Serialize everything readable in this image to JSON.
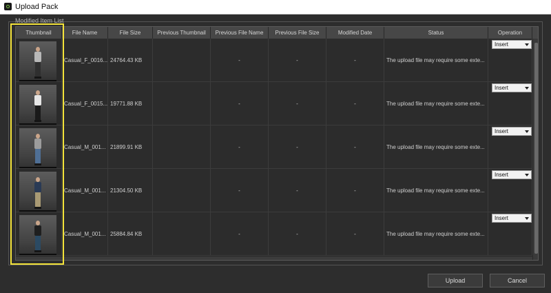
{
  "window": {
    "title": "Upload Pack"
  },
  "group": {
    "label": "Modified Item List"
  },
  "table": {
    "headers": [
      "Thumbnail",
      "File Name",
      "File Size",
      "Previous Thumbnail",
      "Previous File Name",
      "Previous File Size",
      "Modified Date",
      "Status",
      "Operation"
    ],
    "rows": [
      {
        "file_name": "Casual_F_0016...",
        "file_size": "24764.43 KB",
        "prev_thumb": "",
        "prev_name": "-",
        "prev_size": "-",
        "modified_date": "-",
        "status": "The upload file may require some exte...",
        "operation": "Insert",
        "figure": {
          "top": "#b8b8b8",
          "legs": "#2f2f2f"
        }
      },
      {
        "file_name": "Casual_F_0015...",
        "file_size": "19771.88 KB",
        "prev_thumb": "",
        "prev_name": "-",
        "prev_size": "-",
        "modified_date": "-",
        "status": "The upload file may require some exte...",
        "operation": "Insert",
        "figure": {
          "top": "#e6e6e6",
          "legs": "#1a1a1a"
        }
      },
      {
        "file_name": "Casual_M_001...",
        "file_size": "21899.91 KB",
        "prev_thumb": "",
        "prev_name": "-",
        "prev_size": "-",
        "modified_date": "-",
        "status": "The upload file may require some exte...",
        "operation": "Insert",
        "figure": {
          "top": "#9c9c9c",
          "legs": "#4f6f95"
        }
      },
      {
        "file_name": "Casual_M_001...",
        "file_size": "21304.50 KB",
        "prev_thumb": "",
        "prev_name": "-",
        "prev_size": "-",
        "modified_date": "-",
        "status": "The upload file may require some exte...",
        "operation": "Insert",
        "figure": {
          "top": "#2a3a55",
          "legs": "#a99a74"
        }
      },
      {
        "file_name": "Casual_M_001...",
        "file_size": "25884.84 KB",
        "prev_thumb": "",
        "prev_name": "-",
        "prev_size": "-",
        "modified_date": "-",
        "status": "The upload file may require some exte...",
        "operation": "Insert",
        "figure": {
          "top": "#1f1f1f",
          "legs": "#2b4a63"
        }
      }
    ]
  },
  "buttons": {
    "upload": "Upload",
    "cancel": "Cancel"
  },
  "colors": {
    "highlight": "#f5e43a",
    "background": "#2d2d2d",
    "header": "#474747"
  }
}
